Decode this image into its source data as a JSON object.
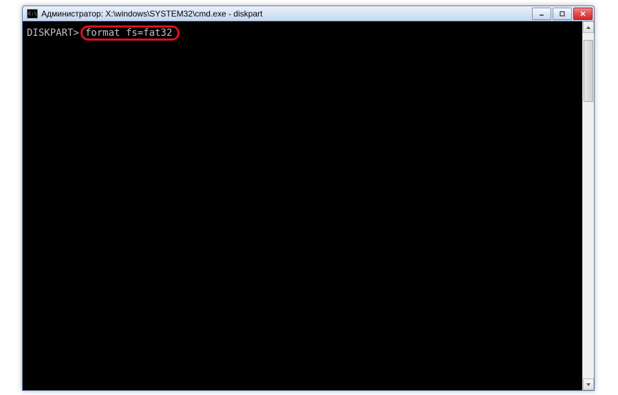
{
  "window": {
    "title": "Администратор: X:\\windows\\SYSTEM32\\cmd.exe - diskpart"
  },
  "console": {
    "prompt": "DISKPART>",
    "command": "format fs=fat32"
  }
}
